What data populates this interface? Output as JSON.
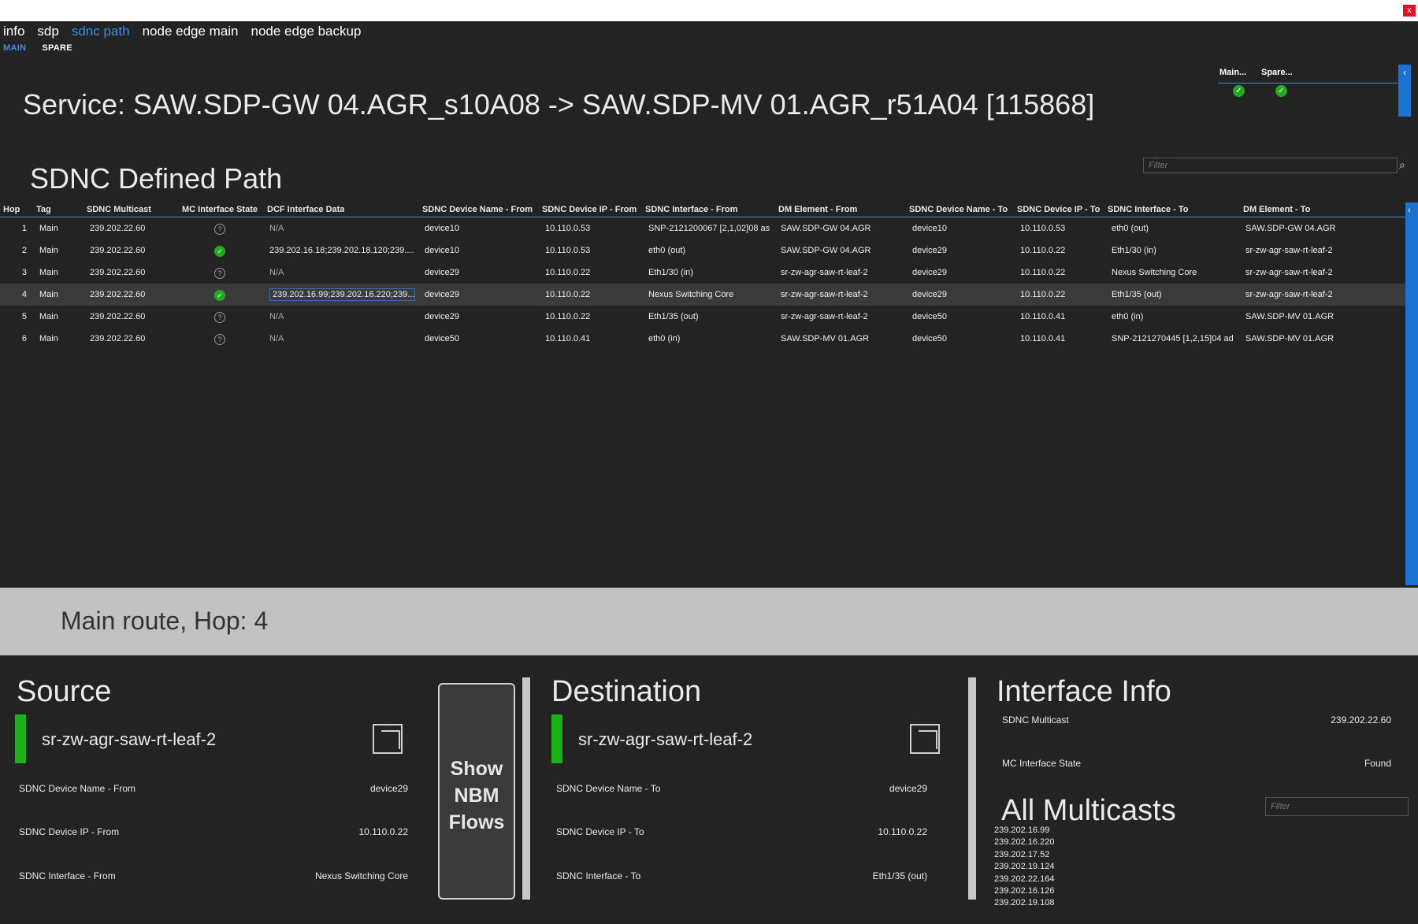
{
  "window": {
    "close_label": "x"
  },
  "menu": {
    "items": [
      "info",
      "sdp",
      "sdnc path",
      "node edge main",
      "node edge backup"
    ],
    "active": "sdnc path"
  },
  "submenu": {
    "items": [
      "MAIN",
      "SPARE"
    ],
    "active": "MAIN"
  },
  "status": {
    "main_label": "Main...",
    "spare_label": "Spare...",
    "main_state": "ok",
    "spare_state": "ok"
  },
  "service_title": "Service: SAW.SDP-GW 04.AGR_s10A08 -> SAW.SDP-MV 01.AGR_r51A04 [115868]",
  "section_title": "SDNC Defined Path",
  "filter_placeholder": "Filter",
  "table": {
    "headers": [
      "Hop",
      "Tag",
      "SDNC Multicast",
      "MC Interface State",
      "DCF Interface Data",
      "SDNC Device Name - From",
      "SDNC Device IP - From",
      "SDNC Interface - From",
      "DM Element - From",
      "SDNC Device Name - To",
      "SDNC Device IP - To",
      "SDNC Interface - To",
      "DM Element - To"
    ],
    "rows": [
      {
        "hop": "1",
        "tag": "Main",
        "mc": "239.202.22.60",
        "state": "unknown",
        "dcf": "N/A",
        "dev_from": "device10",
        "ip_from": "10.110.0.53",
        "if_from": "SNP-2121200067 [2,1,02]08 as",
        "dm_from": "SAW.SDP-GW 04.AGR",
        "dev_to": "device10",
        "ip_to": "10.110.0.53",
        "if_to": "eth0 (out)",
        "dm_to": "SAW.SDP-GW 04.AGR"
      },
      {
        "hop": "2",
        "tag": "Main",
        "mc": "239.202.22.60",
        "state": "ok",
        "dcf": "239.202.16.18;239.202.18.120;239....",
        "dev_from": "device10",
        "ip_from": "10.110.0.53",
        "if_from": "eth0 (out)",
        "dm_from": "SAW.SDP-GW 04.AGR",
        "dev_to": "device29",
        "ip_to": "10.110.0.22",
        "if_to": "Eth1/30 (in)",
        "dm_to": "sr-zw-agr-saw-rt-leaf-2"
      },
      {
        "hop": "3",
        "tag": "Main",
        "mc": "239.202.22.60",
        "state": "unknown",
        "dcf": "N/A",
        "dev_from": "device29",
        "ip_from": "10.110.0.22",
        "if_from": "Eth1/30 (in)",
        "dm_from": "sr-zw-agr-saw-rt-leaf-2",
        "dev_to": "device29",
        "ip_to": "10.110.0.22",
        "if_to": "Nexus Switching Core",
        "dm_to": "sr-zw-agr-saw-rt-leaf-2"
      },
      {
        "hop": "4",
        "tag": "Main",
        "mc": "239.202.22.60",
        "state": "ok",
        "dcf": "239.202.16.99;239.202.16.220;239....",
        "dev_from": "device29",
        "ip_from": "10.110.0.22",
        "if_from": "Nexus Switching Core",
        "dm_from": "sr-zw-agr-saw-rt-leaf-2",
        "dev_to": "device29",
        "ip_to": "10.110.0.22",
        "if_to": "Eth1/35 (out)",
        "dm_to": "sr-zw-agr-saw-rt-leaf-2"
      },
      {
        "hop": "5",
        "tag": "Main",
        "mc": "239.202.22.60",
        "state": "unknown",
        "dcf": "N/A",
        "dev_from": "device29",
        "ip_from": "10.110.0.22",
        "if_from": "Eth1/35 (out)",
        "dm_from": "sr-zw-agr-saw-rt-leaf-2",
        "dev_to": "device50",
        "ip_to": "10.110.0.41",
        "if_to": "eth0 (in)",
        "dm_to": "SAW.SDP-MV 01.AGR"
      },
      {
        "hop": "6",
        "tag": "Main",
        "mc": "239.202.22.60",
        "state": "unknown",
        "dcf": "N/A",
        "dev_from": "device50",
        "ip_from": "10.110.0.41",
        "if_from": "eth0 (in)",
        "dm_from": "SAW.SDP-MV 01.AGR",
        "dev_to": "device50",
        "ip_to": "10.110.0.41",
        "if_to": "SNP-2121270445 [1,2,15]04 ad",
        "dm_to": "SAW.SDP-MV 01.AGR"
      }
    ],
    "selected_hop": "4"
  },
  "route_label": "Main route, Hop: 4",
  "source": {
    "title": "Source",
    "node": "sr-zw-agr-saw-rt-leaf-2",
    "fields": [
      {
        "label": "SDNC Device Name - From",
        "value": "device29"
      },
      {
        "label": "SDNC Device IP - From",
        "value": "10.110.0.22"
      },
      {
        "label": "SDNC Interface - From",
        "value": "Nexus Switching Core"
      }
    ]
  },
  "nbm_button": {
    "line1": "Show",
    "line2": "NBM",
    "line3": "Flows"
  },
  "destination": {
    "title": "Destination",
    "node": "sr-zw-agr-saw-rt-leaf-2",
    "fields": [
      {
        "label": "SDNC Device Name - To",
        "value": "device29"
      },
      {
        "label": "SDNC Device IP - To",
        "value": "10.110.0.22"
      },
      {
        "label": "SDNC Interface - To",
        "value": "Eth1/35 (out)"
      }
    ]
  },
  "interface_info": {
    "title": "Interface Info",
    "fields": [
      {
        "label": "SDNC Multicast",
        "value": "239.202.22.60"
      },
      {
        "label": "MC Interface State",
        "value": "Found"
      }
    ]
  },
  "all_multicasts": {
    "title": "All Multicasts",
    "items": [
      "239.202.16.99",
      "239.202.16.220",
      "239.202.17.52",
      "239.202.19.124",
      "239.202.22.164",
      "239.202.16.126",
      "239.202.19.108"
    ]
  },
  "colors": {
    "accent": "#3c8ee0",
    "ok": "#22aa22",
    "node_bar": "#19b319"
  }
}
